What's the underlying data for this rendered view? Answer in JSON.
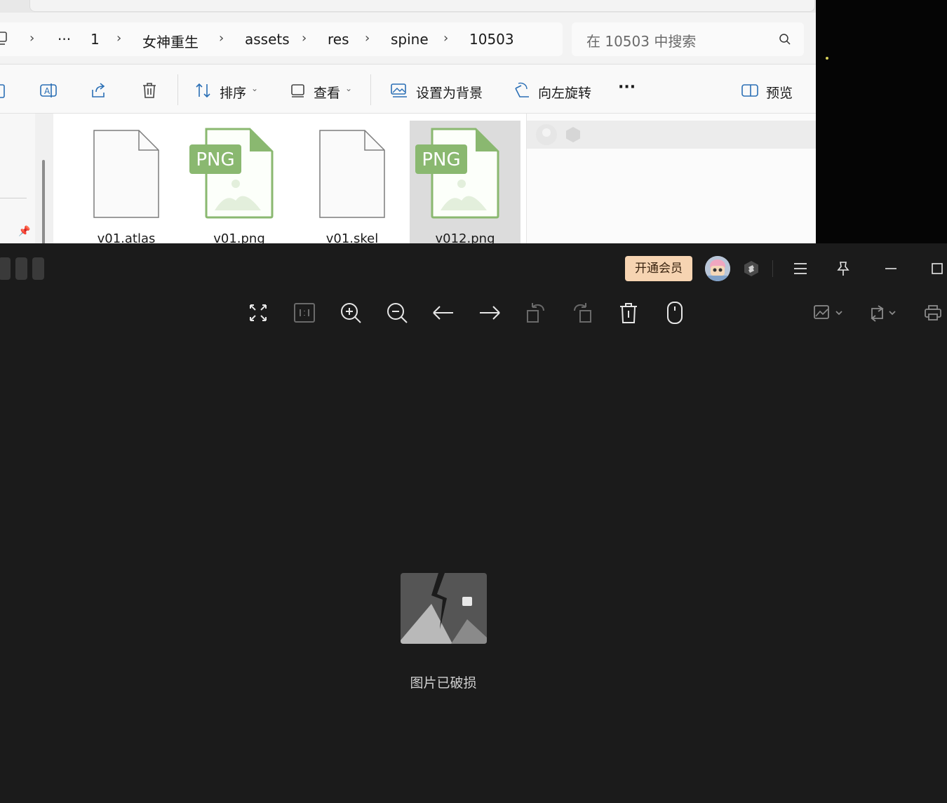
{
  "explorer": {
    "breadcrumb": {
      "ellipsis": "···",
      "items": [
        "1",
        "女神重生",
        "assets",
        "res",
        "spine",
        "10503"
      ]
    },
    "search": {
      "placeholder": "在 10503 中搜索"
    },
    "toolbar": {
      "sort_label": "排序",
      "view_label": "查看",
      "set_background_label": "设置为背景",
      "rotate_left_label": "向左旋转",
      "more_label": "···",
      "preview_label": "预览"
    },
    "files": [
      {
        "name": "v01.atlas",
        "type": "generic",
        "selected": false
      },
      {
        "name": "v01.png",
        "type": "png",
        "badge": "PNG",
        "selected": false
      },
      {
        "name": "v01.skel",
        "type": "generic",
        "selected": false
      },
      {
        "name": "v012.png",
        "type": "png",
        "badge": "PNG",
        "selected": true
      }
    ]
  },
  "viewer": {
    "vip_button": "开通会员",
    "status_message": "图片已破损",
    "colors": {
      "background": "#1b1b1b",
      "vip_bg": "#f6d4b2",
      "png_green": "#8ab870"
    }
  }
}
